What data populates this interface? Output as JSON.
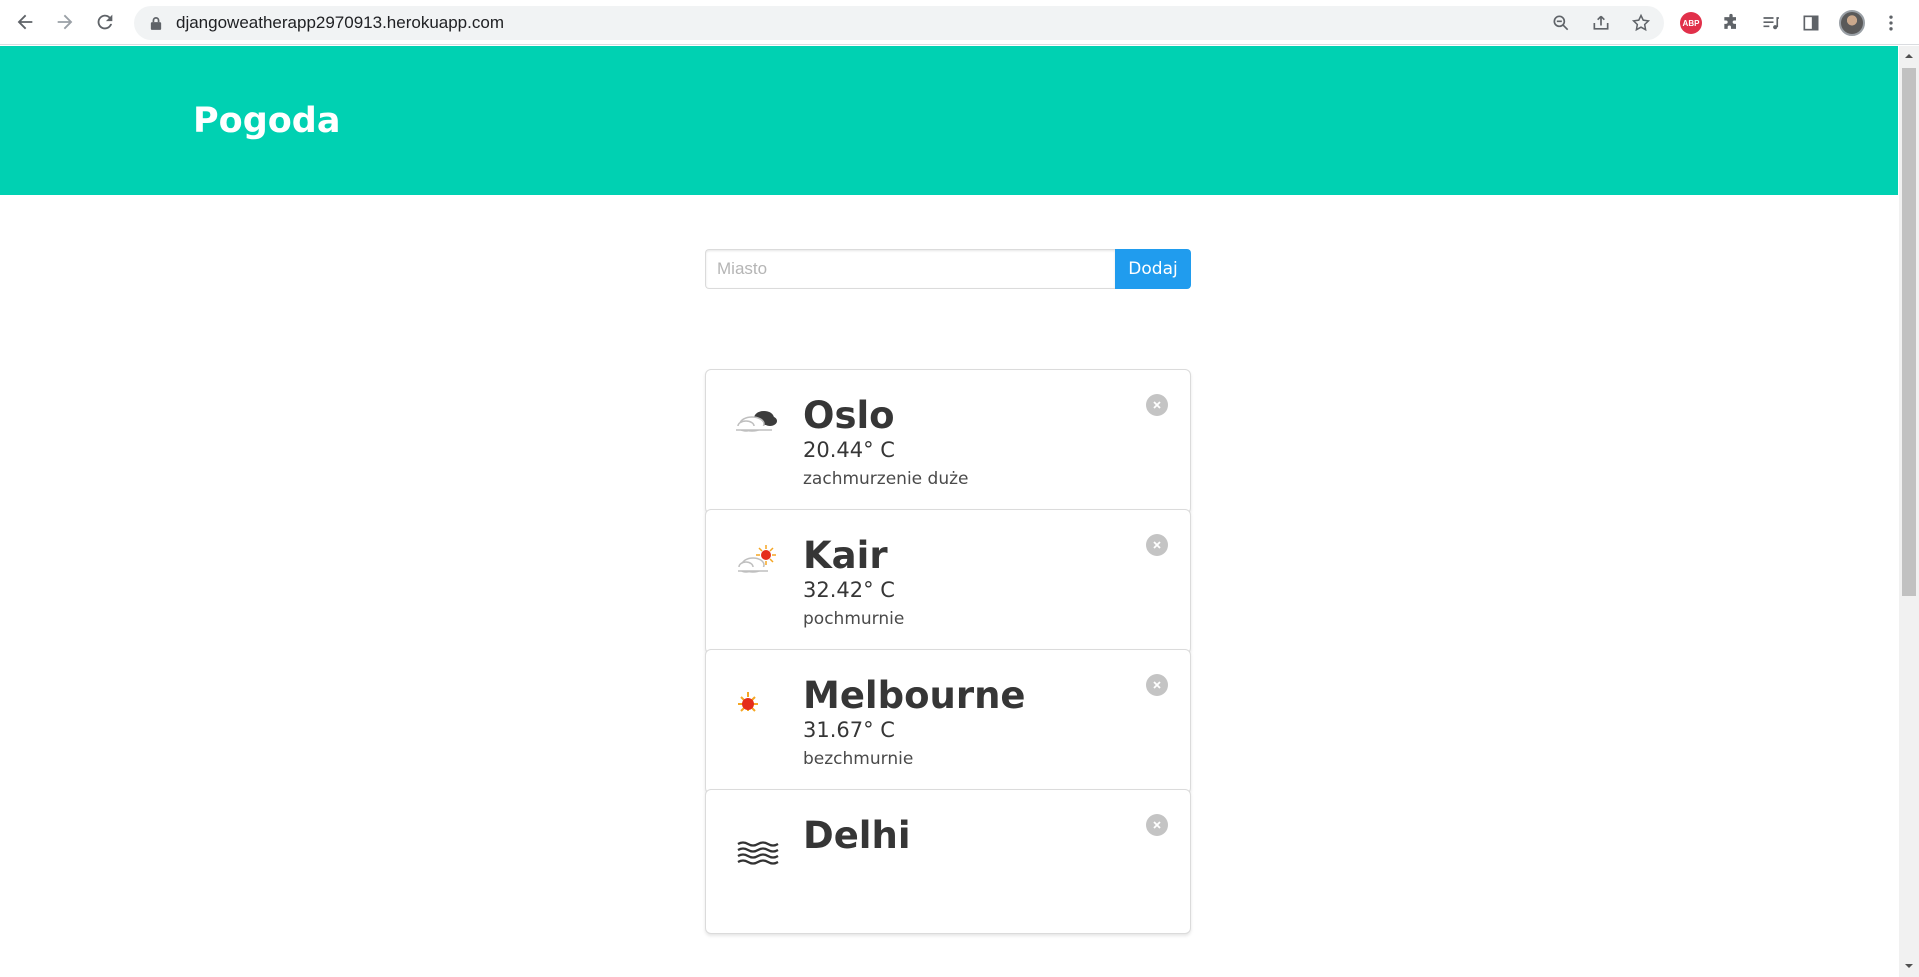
{
  "browser": {
    "url": "djangoweatherapp2970913.herokuapp.com"
  },
  "header": {
    "title": "Pogoda"
  },
  "form": {
    "placeholder": "Miasto",
    "button_label": "Dodaj"
  },
  "cards": [
    {
      "city": "Oslo",
      "temp": "20.44° C",
      "desc": "zachmurzenie duże",
      "icon": "broken-clouds-icon"
    },
    {
      "city": "Kair",
      "temp": "32.42° C",
      "desc": "pochmurnie",
      "icon": "few-clouds-icon"
    },
    {
      "city": "Melbourne",
      "temp": "31.67° C",
      "desc": "bezchmurnie",
      "icon": "clear-sky-icon"
    },
    {
      "city": "Delhi",
      "icon": "haze-icon"
    }
  ],
  "colors": {
    "hero": "#00d1b2",
    "button": "#209cee"
  }
}
